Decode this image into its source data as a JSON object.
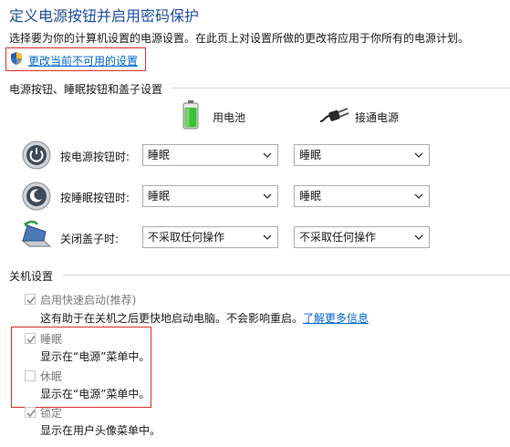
{
  "header": {
    "title": "定义电源按钮并启用密码保护",
    "subtitle": "选择要为你的计算机设置的电源设置。在此页上对设置所做的更改将应用于你所有的电源计划。",
    "change_link": "更改当前不可用的设置"
  },
  "power_section": {
    "title": "电源按钮、睡眠按钮和盖子设置",
    "columns": {
      "battery": "用电池",
      "plugged": "接通电源"
    },
    "rows": [
      {
        "label": "按电源按钮时:",
        "battery": "睡眠",
        "plugged": "睡眠"
      },
      {
        "label": "按睡眠按钮时:",
        "battery": "睡眠",
        "plugged": "睡眠"
      },
      {
        "label": "关闭盖子时:",
        "battery": "不采取任何操作",
        "plugged": "不采取任何操作"
      }
    ]
  },
  "shutdown_section": {
    "title": "关机设置",
    "items": [
      {
        "label": "启用快速启动(推荐)",
        "desc": "这有助于在关机之后更快地启动电脑。不会影响重启。",
        "link": "了解更多信息",
        "checked": true
      },
      {
        "label": "睡眠",
        "desc": "显示在“电源”菜单中。",
        "checked": true
      },
      {
        "label": "休眠",
        "desc": "显示在“电源”菜单中。",
        "checked": false
      },
      {
        "label": "锁定",
        "desc": "显示在用户头像菜单中。",
        "checked": true
      }
    ]
  },
  "colors": {
    "title": "#1e4e9c",
    "link": "#0066cc",
    "highlight_box": "#d9342b"
  },
  "icons": [
    "shield-icon",
    "battery-icon",
    "power-plug-icon",
    "power-button-icon",
    "sleep-button-icon",
    "laptop-lid-icon",
    "chevron-down-icon",
    "checkmark-icon"
  ]
}
